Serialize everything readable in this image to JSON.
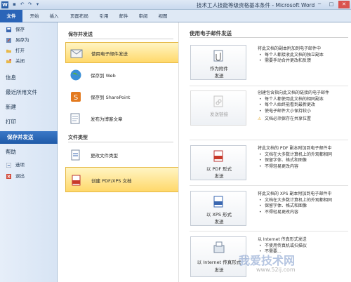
{
  "window": {
    "title": "技术工人技能等级资格基本条件 - Microsoft Word",
    "app_icon": "W",
    "quick_access": [
      "save-icon",
      "undo-icon",
      "redo-icon",
      "customize-icon"
    ],
    "controls": {
      "minimize": "─",
      "maximize": "□",
      "close": "✕"
    }
  },
  "ribbon": {
    "tabs": [
      "文件",
      "开始",
      "插入",
      "页面布局",
      "引用",
      "邮件",
      "审阅",
      "视图"
    ]
  },
  "sidebar": {
    "small_items": [
      {
        "label": "保存",
        "icon": "save-icon"
      },
      {
        "label": "另存为",
        "icon": "save-as-icon"
      },
      {
        "label": "打开",
        "icon": "folder-open-icon"
      },
      {
        "label": "关闭",
        "icon": "close-doc-icon"
      }
    ],
    "big_items": [
      "信息",
      "最近所用文件",
      "新建",
      "打印",
      "保存并发送",
      "帮助"
    ],
    "active": "保存并发送",
    "bottom_items": [
      {
        "label": "选项",
        "icon": "options-icon"
      },
      {
        "label": "退出",
        "icon": "exit-icon"
      }
    ]
  },
  "middle": {
    "send_header": "保存并发送",
    "send_items": [
      {
        "label": "使用电子邮件发送",
        "icon": "email-icon",
        "selected": true
      },
      {
        "label": "保存到 Web",
        "icon": "web-globe-icon",
        "selected": false
      },
      {
        "label": "保存到 SharePoint",
        "icon": "sharepoint-icon",
        "selected": false
      },
      {
        "label": "发布为博客文章",
        "icon": "blog-icon",
        "selected": false
      }
    ],
    "filetype_header": "文件类型",
    "filetype_items": [
      {
        "label": "更改文件类型",
        "icon": "change-type-icon",
        "selected": false
      },
      {
        "label": "创建 PDF/XPS 文档",
        "icon": "pdf-xps-icon",
        "selected": true
      }
    ]
  },
  "right": {
    "title": "使用电子邮件发送",
    "options": [
      {
        "button": [
          "作为附件",
          "发送"
        ],
        "icon": "attachment-icon",
        "disabled": false,
        "heading": "将此文档的副本附加到电子邮件中",
        "bullets": [
          "每个人都接收此文档的独立副本",
          "需要手动合并更改和反馈"
        ],
        "warning": ""
      },
      {
        "button": [
          "发送链接",
          ""
        ],
        "icon": "link-icon",
        "disabled": true,
        "heading": "创建包含指向此文档的链接的电子邮件",
        "bullets": [
          "每个人都使用此文档的相同副本",
          "每个人始终能看到最新更改",
          "使电子邮件大小保持较小"
        ],
        "warning": "文档必须保存在共享位置"
      },
      {
        "button": [
          "以 PDF 形式",
          "发送"
        ],
        "icon": "pdf-icon",
        "disabled": false,
        "heading": "将此文档的 PDF 副本附加到电子邮件中",
        "bullets": [
          "文档在大多数计算机上的外观都相同",
          "保留字体、格式和图像",
          "不得轻易更改内容"
        ],
        "warning": ""
      },
      {
        "button": [
          "以 XPS 形式",
          "发送"
        ],
        "icon": "xps-icon",
        "disabled": false,
        "heading": "将此文档的 XPS 副本附加到电子邮件中",
        "bullets": [
          "文档在大多数计算机上的外观都相同",
          "保留字体、格式和图像",
          "不得轻易更改内容"
        ],
        "warning": ""
      },
      {
        "button": [
          "以 Internet 传真形式",
          "发送"
        ],
        "icon": "fax-icon",
        "disabled": false,
        "heading": "以 Internet 传真形式发送",
        "bullets": [
          "不使用传真机或扫描仪",
          "不需要..."
        ],
        "warning": ""
      }
    ]
  },
  "watermark": {
    "line1": "我爱技术网",
    "line2": "www.52ij.com"
  }
}
